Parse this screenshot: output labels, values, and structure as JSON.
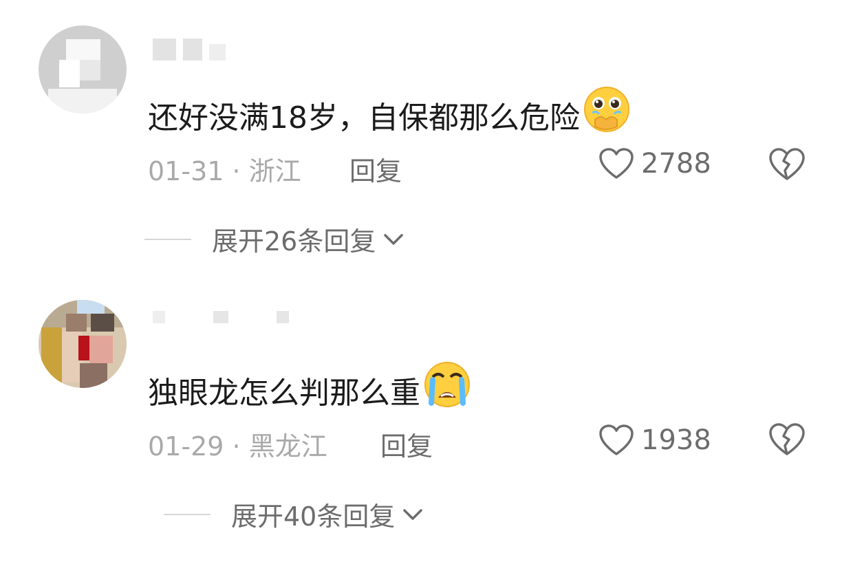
{
  "comments": [
    {
      "text": "还好没满18岁，自保都那么危险",
      "emoji": "pleading-face-hands-over-mouth",
      "date": "01-31",
      "separator": "·",
      "location": "浙江",
      "reply_label": "回复",
      "likes": "2788",
      "expand_label": "展开26条回复"
    },
    {
      "text": "独眼龙怎么判那么重",
      "emoji": "loudly-crying-face",
      "date": "01-29",
      "separator": "·",
      "location": "黑龙江",
      "reply_label": "回复",
      "likes": "1938",
      "expand_label": "展开40条回复"
    }
  ],
  "icons": {
    "like": "heart-outline-icon",
    "dislike": "broken-heart-icon",
    "expand": "chevron-down-icon"
  },
  "colors": {
    "text": "#1b1b1b",
    "meta": "#a9a9a9",
    "secondary": "#6c6c6c"
  }
}
